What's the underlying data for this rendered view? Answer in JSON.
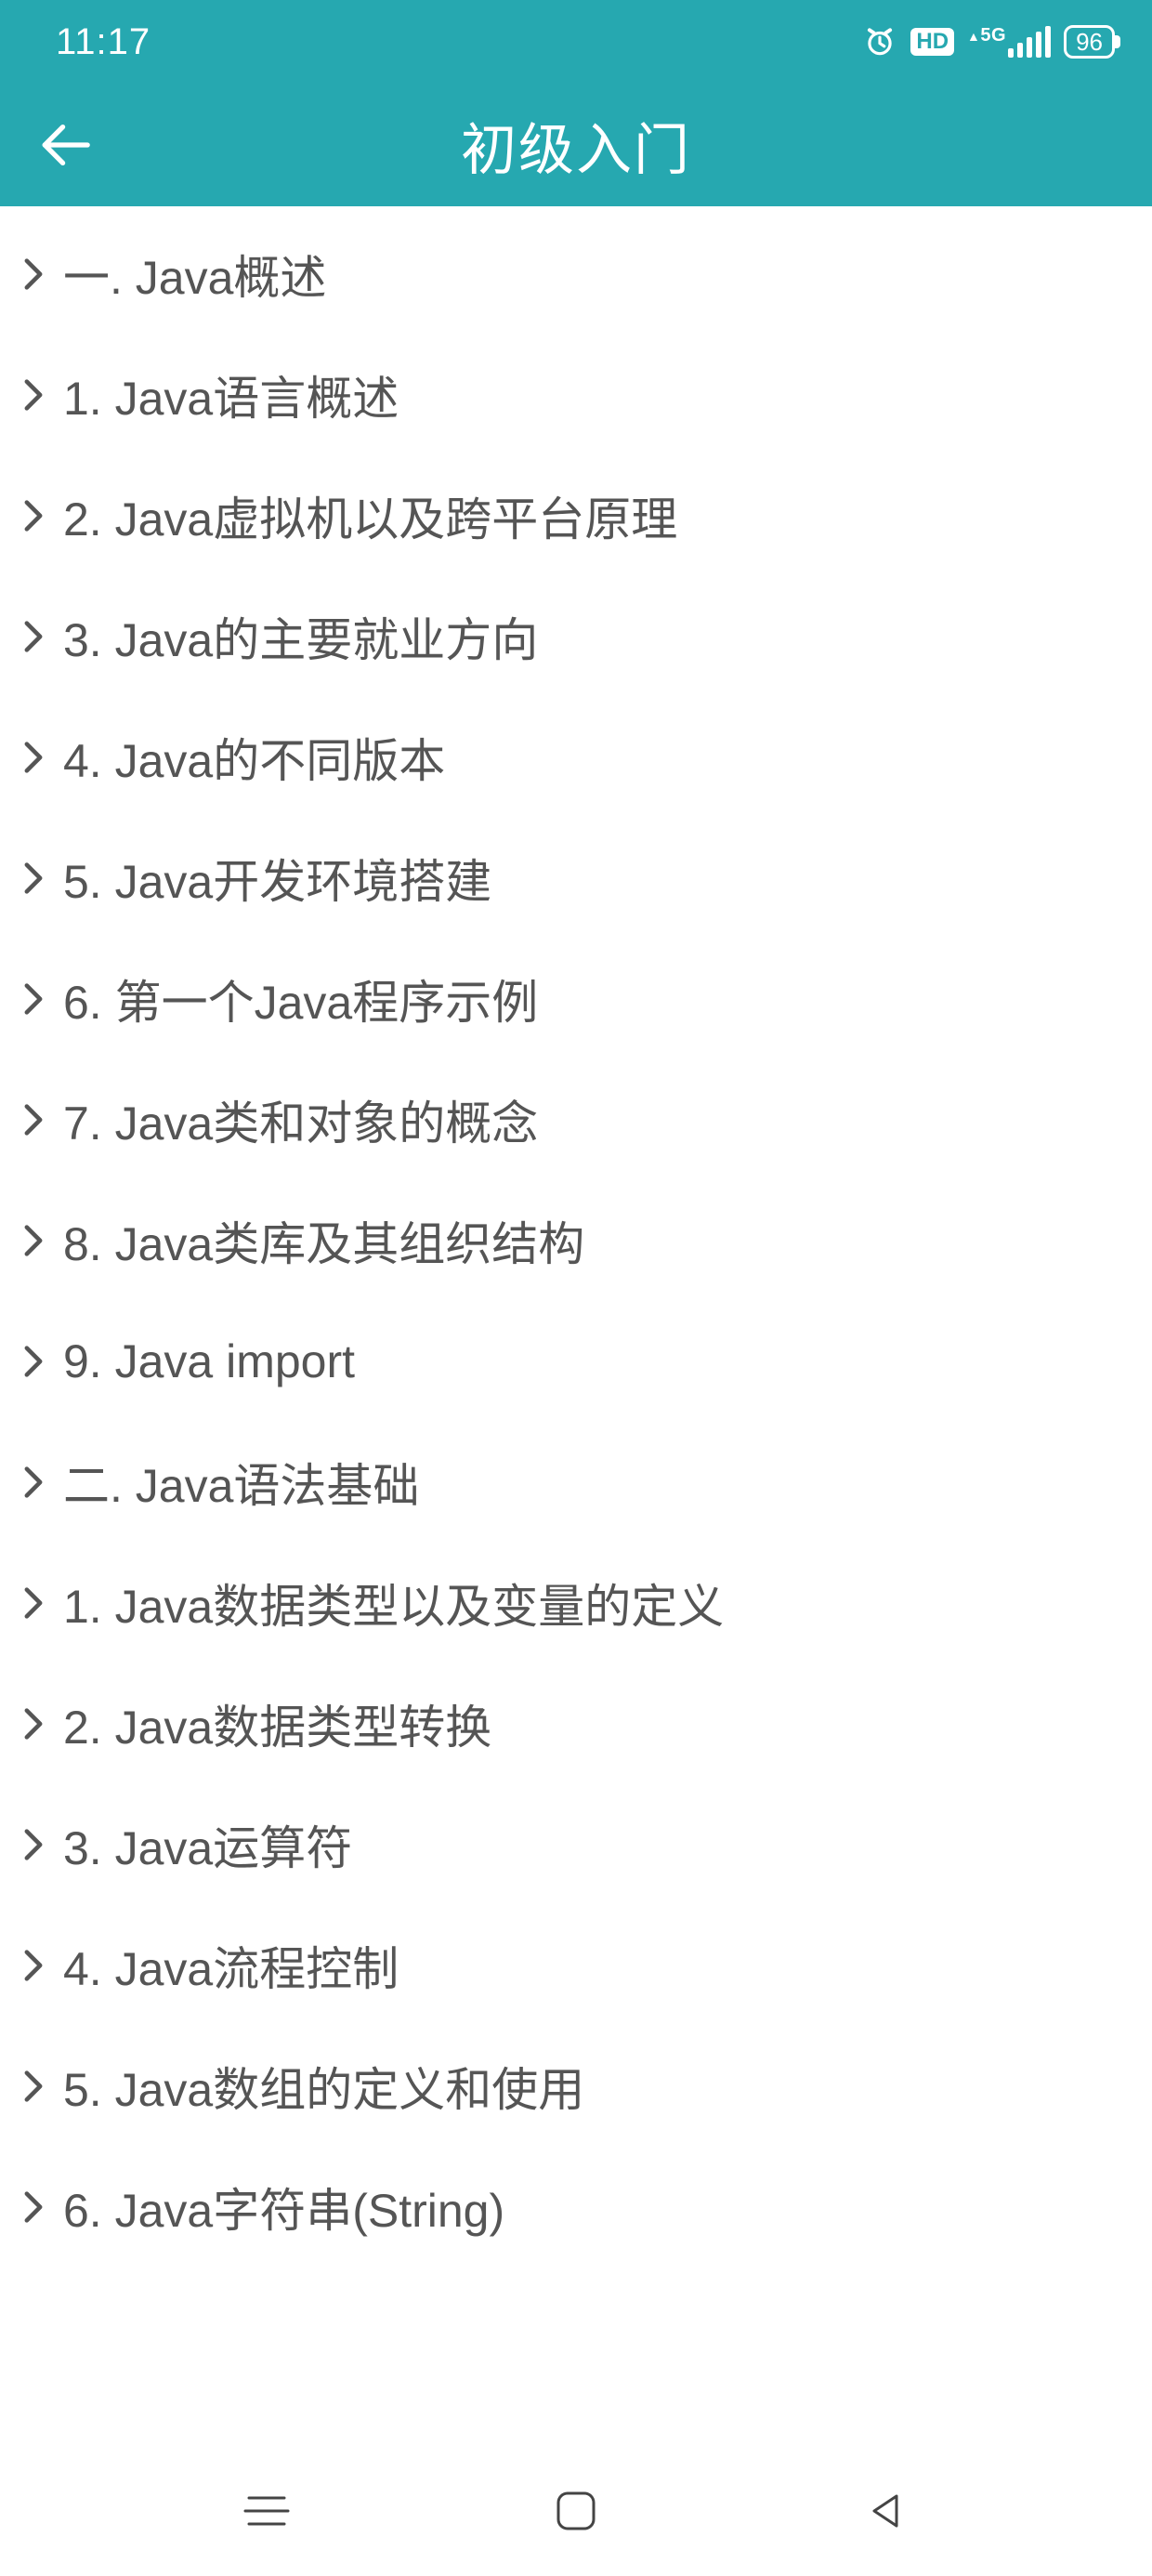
{
  "status": {
    "time": "11:17",
    "network_label": "5G",
    "hd_label": "HD",
    "battery": "96"
  },
  "header": {
    "title": "初级入门"
  },
  "items": [
    {
      "label": "一. Java概述"
    },
    {
      "label": "1. Java语言概述"
    },
    {
      "label": "2. Java虚拟机以及跨平台原理"
    },
    {
      "label": "3. Java的主要就业方向"
    },
    {
      "label": "4. Java的不同版本"
    },
    {
      "label": "5. Java开发环境搭建"
    },
    {
      "label": "6. 第一个Java程序示例"
    },
    {
      "label": "7. Java类和对象的概念"
    },
    {
      "label": "8. Java类库及其组织结构"
    },
    {
      "label": "9. Java import"
    },
    {
      "label": "二. Java语法基础"
    },
    {
      "label": "1. Java数据类型以及变量的定义"
    },
    {
      "label": "2. Java数据类型转换"
    },
    {
      "label": "3. Java运算符"
    },
    {
      "label": "4. Java流程控制"
    },
    {
      "label": "5. Java数组的定义和使用"
    },
    {
      "label": "6. Java字符串(String)"
    }
  ]
}
